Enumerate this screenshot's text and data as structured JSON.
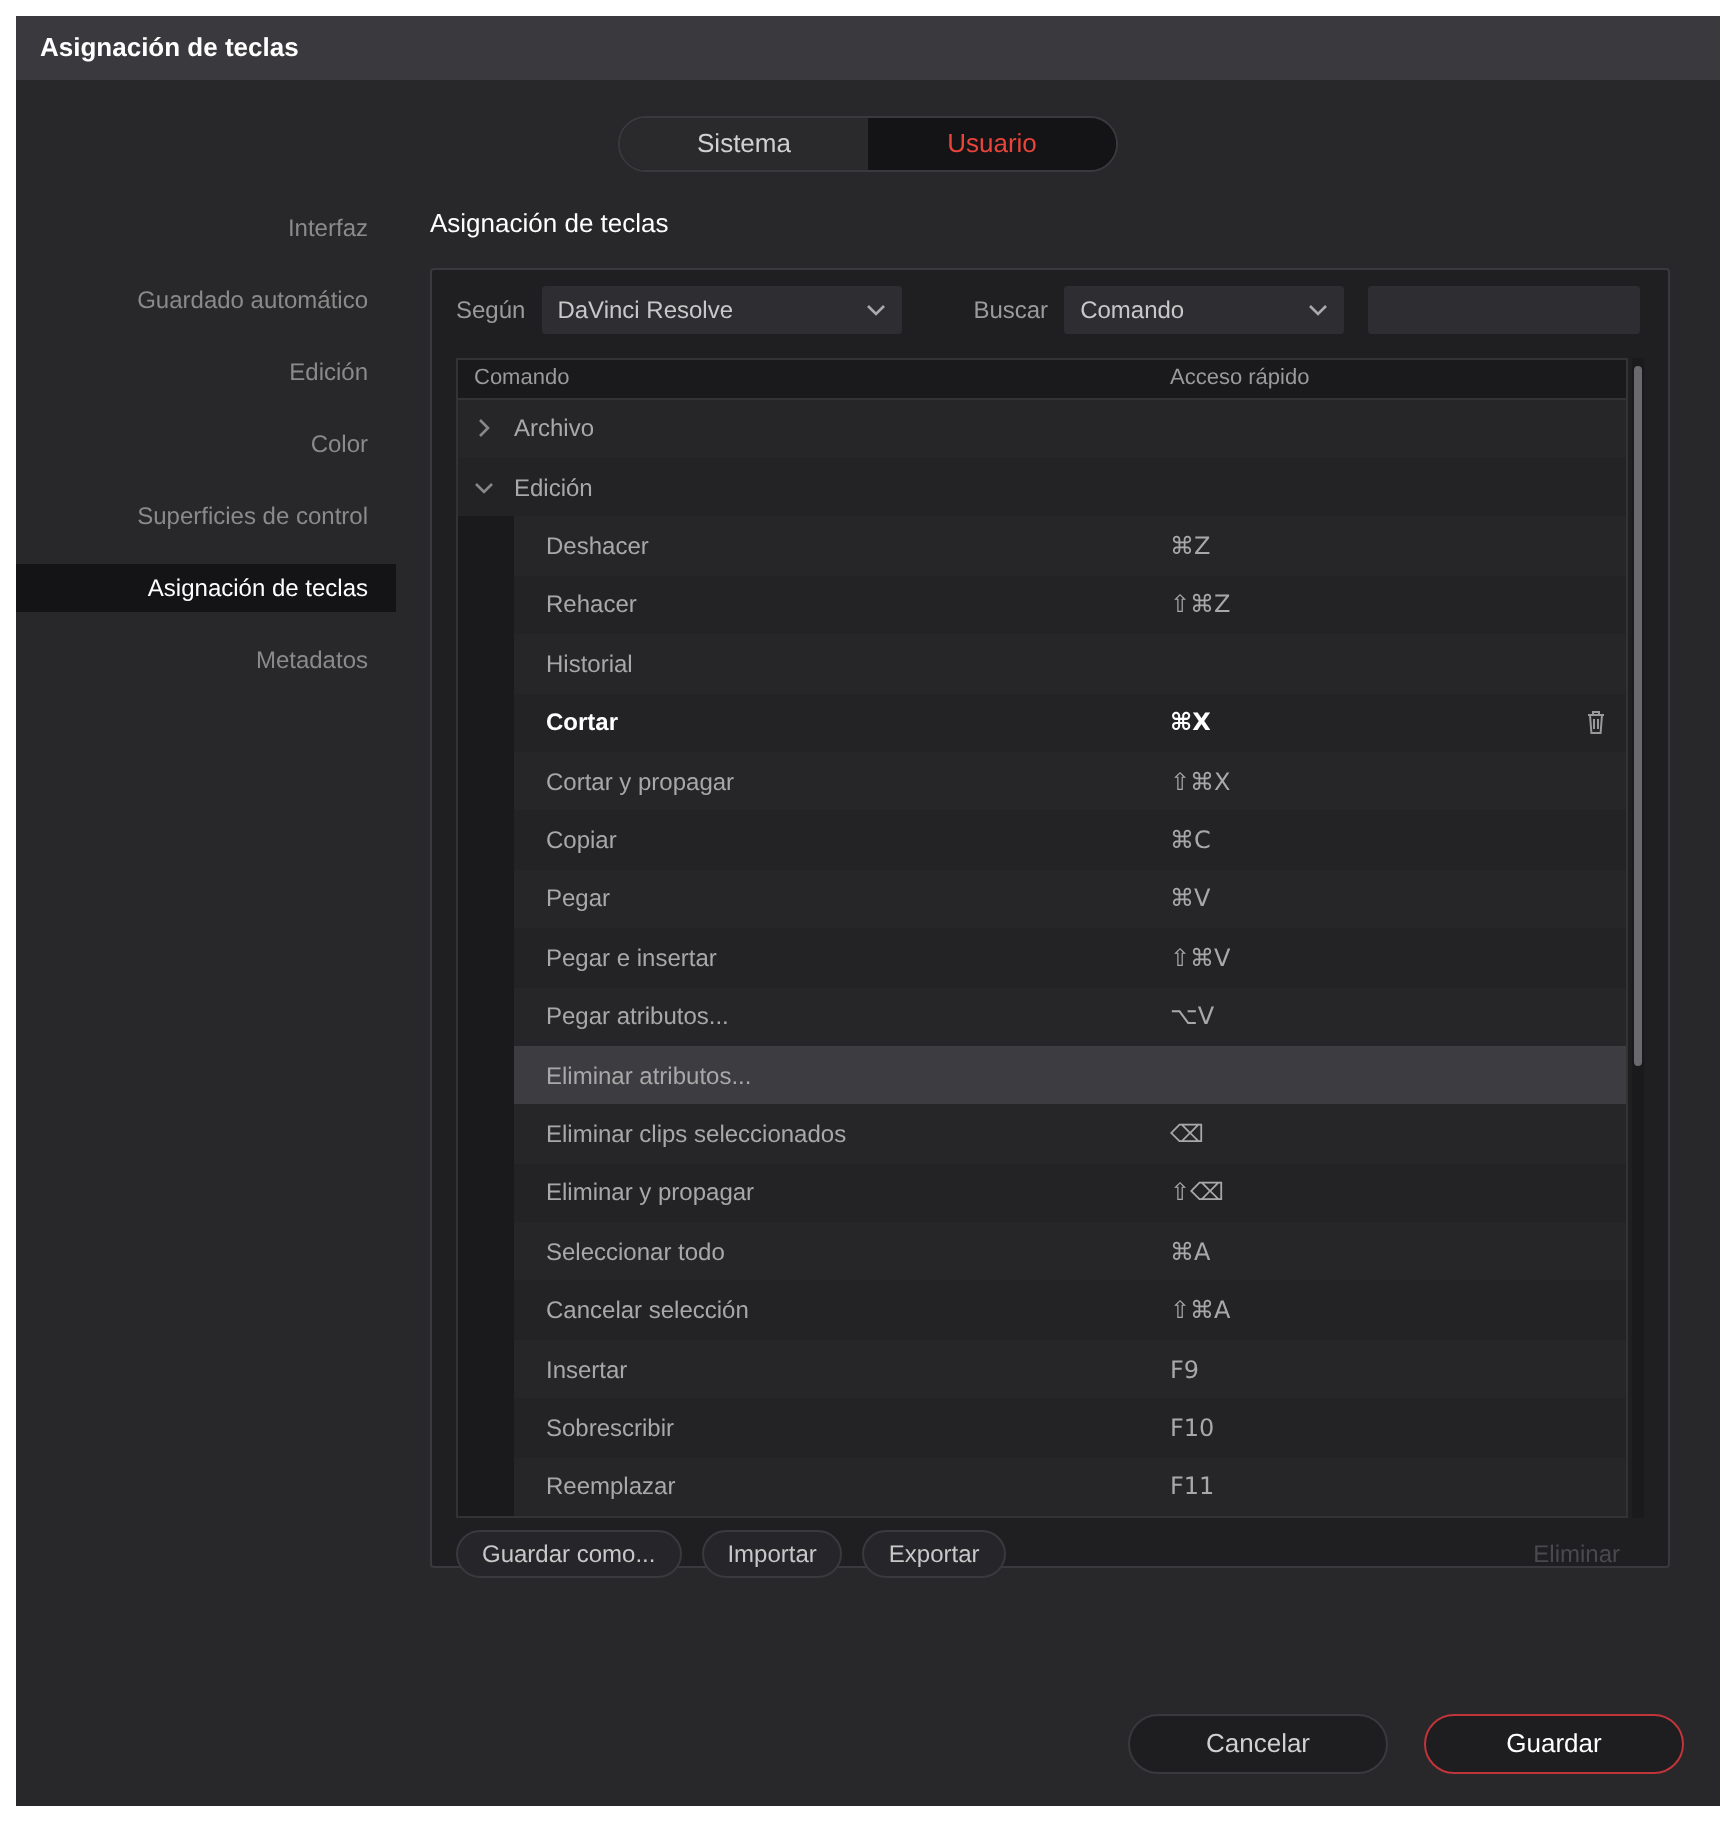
{
  "window": {
    "title": "Asignación de teclas"
  },
  "tabs": [
    {
      "label": "Sistema",
      "selected": false
    },
    {
      "label": "Usuario",
      "selected": true
    }
  ],
  "sidebar": {
    "items": [
      {
        "label": "Interfaz",
        "selected": false
      },
      {
        "label": "Guardado automático",
        "selected": false
      },
      {
        "label": "Edición",
        "selected": false
      },
      {
        "label": "Color",
        "selected": false
      },
      {
        "label": "Superficies de control",
        "selected": false
      },
      {
        "label": "Asignación de teclas",
        "selected": true
      },
      {
        "label": "Metadatos",
        "selected": false
      }
    ]
  },
  "panel": {
    "title": "Asignación de teclas",
    "preset": {
      "label": "Según",
      "value": "DaVinci Resolve"
    },
    "search": {
      "label": "Buscar",
      "value": "Comando"
    },
    "table": {
      "columns": [
        "Comando",
        "Acceso rápido"
      ],
      "rows": [
        {
          "command": "Archivo",
          "expanded": false,
          "children": []
        },
        {
          "command": "Edición",
          "expanded": true,
          "children": [
            {
              "command": "Deshacer",
              "shortcut": "⌘Z",
              "selected": false,
              "hovered": false
            },
            {
              "command": "Rehacer",
              "shortcut": "⇧⌘Z",
              "selected": false,
              "hovered": false
            },
            {
              "command": "Historial",
              "selected": false,
              "hovered": false
            },
            {
              "command": "Cortar",
              "shortcut": "⌘X",
              "selected": true,
              "hovered": false
            },
            {
              "command": "Cortar y propagar",
              "shortcut": "⇧⌘X",
              "selected": false,
              "hovered": false
            },
            {
              "command": "Copiar",
              "shortcut": "⌘C",
              "selected": false,
              "hovered": false
            },
            {
              "command": "Pegar",
              "shortcut": "⌘V",
              "selected": false,
              "hovered": false
            },
            {
              "command": "Pegar e insertar",
              "shortcut": "⇧⌘V",
              "selected": false,
              "hovered": false
            },
            {
              "command": "Pegar atributos...",
              "shortcut": "⌥V",
              "selected": false,
              "hovered": false
            },
            {
              "command": "Eliminar atributos...",
              "selected": false,
              "hovered": true
            },
            {
              "command": "Eliminar clips seleccionados",
              "shortcut": "⌫",
              "selected": false,
              "hovered": false
            },
            {
              "command": "Eliminar y propagar",
              "shortcut": "⇧⌫",
              "selected": false,
              "hovered": false
            },
            {
              "command": "Seleccionar todo",
              "shortcut": "⌘A",
              "selected": false,
              "hovered": false
            },
            {
              "command": "Cancelar selección",
              "shortcut": "⇧⌘A",
              "selected": false,
              "hovered": false
            },
            {
              "command": "Insertar",
              "shortcut": "F9",
              "selected": false,
              "hovered": false
            },
            {
              "command": "Sobrescribir",
              "shortcut": "F10",
              "selected": false,
              "hovered": false
            },
            {
              "command": "Reemplazar",
              "shortcut": "F11",
              "selected": false,
              "hovered": false
            }
          ]
        }
      ]
    },
    "buttons": [
      {
        "label": "Guardar como...",
        "disabled": false
      },
      {
        "label": "Importar",
        "disabled": false
      },
      {
        "label": "Exportar",
        "disabled": false
      },
      {
        "label": "Eliminar",
        "disabled": true
      }
    ]
  },
  "footer": {
    "buttons": [
      {
        "label": "Cancelar",
        "primary": false
      },
      {
        "label": "Guardar",
        "primary": true
      }
    ]
  }
}
